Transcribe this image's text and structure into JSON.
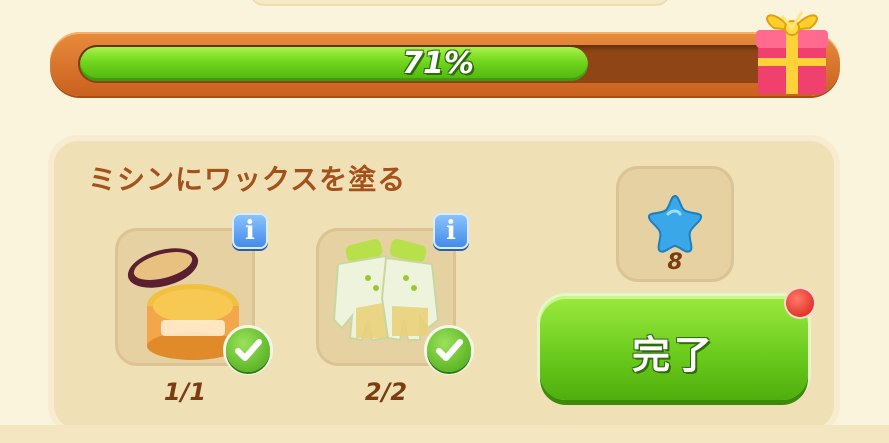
{
  "progress": {
    "label": "71%",
    "value": 0.71
  },
  "task": {
    "title": "ミシンにワックスを塗る",
    "items": [
      {
        "icon": "wax-jar-icon",
        "count": "1/1",
        "complete": true
      },
      {
        "icon": "garden-gloves-icon",
        "count": "2/2",
        "complete": true
      }
    ]
  },
  "reward": {
    "icon": "blue-star-icon",
    "count": "8"
  },
  "complete_button": {
    "label": "完了"
  },
  "colors": {
    "accent_green": "#6ccc1e",
    "progress_frame": "#c9611f",
    "title_brown": "#a4521c"
  }
}
